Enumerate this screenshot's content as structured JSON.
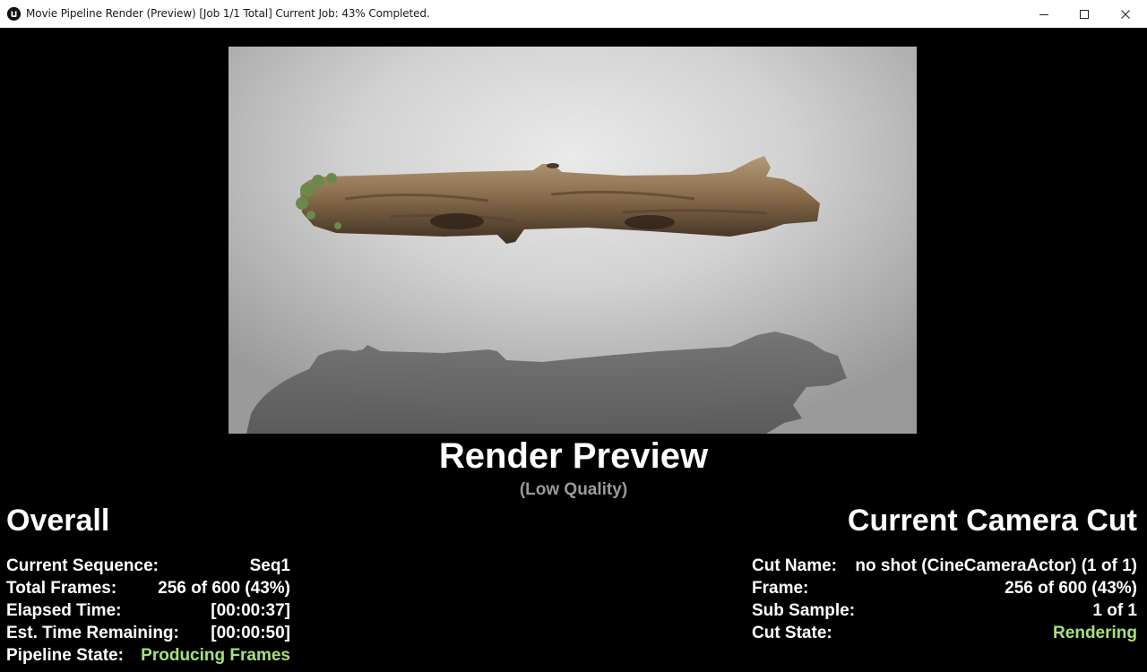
{
  "window": {
    "title": "Movie Pipeline Render (Preview) [Job 1/1 Total] Current Job: 43% Completed.",
    "icon": "unreal-engine-icon",
    "controls": [
      "minimize-icon",
      "maximize-icon",
      "close-icon"
    ]
  },
  "preview": {
    "title": "Render Preview",
    "subtitle": "(Low Quality)",
    "image": "rendered frame of a floating tree log with its shadow on a gray backdrop"
  },
  "overall": {
    "title": "Overall",
    "current_sequence_label": "Current Sequence:",
    "current_sequence_value": "Seq1",
    "total_frames_label": "Total Frames:",
    "total_frames_value": "256 of 600 (43%)",
    "elapsed_time_label": "Elapsed Time:",
    "elapsed_time_value": "[00:00:37]",
    "remaining_label": "Est. Time Remaining:",
    "remaining_value": "[00:00:50]",
    "pipeline_state_label": "Pipeline State:",
    "pipeline_state_value": "Producing Frames"
  },
  "camera_cut": {
    "title": "Current Camera Cut",
    "cut_name_label": "Cut Name:",
    "cut_name_value": "no shot (CineCameraActor) (1 of 1)",
    "frame_label": "Frame:",
    "frame_value": "256 of 600 (43%)",
    "sub_sample_label": "Sub Sample:",
    "sub_sample_value": "1 of 1",
    "cut_state_label": "Cut State:",
    "cut_state_value": "Rendering"
  },
  "colors": {
    "status_green": "#a8e07a",
    "subtitle_gray": "#9a9a9a",
    "background": "#000000"
  }
}
